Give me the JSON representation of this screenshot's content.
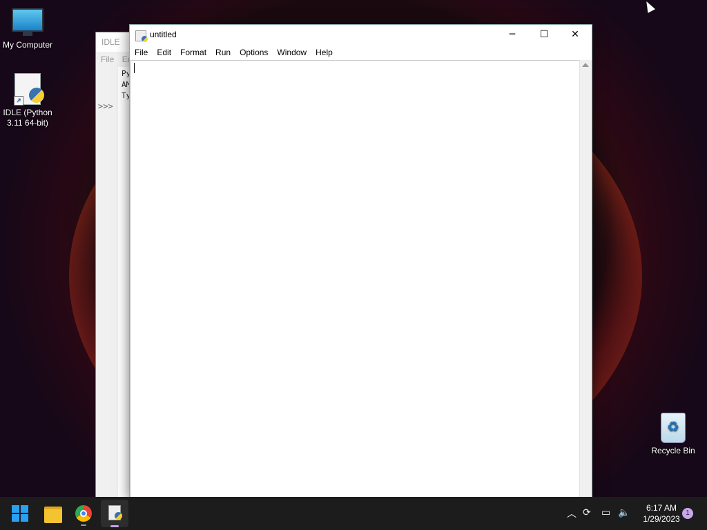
{
  "desktop": {
    "icons": [
      {
        "label": "My Computer",
        "icon": "monitor-icon"
      },
      {
        "label": "IDLE (Python 3.11 64-bit)",
        "icon": "python-shortcut-icon"
      },
      {
        "label": "Recycle Bin",
        "icon": "recycle-bin-icon"
      }
    ]
  },
  "shell_window": {
    "title": "IDLE",
    "menu_first": "File",
    "menu_second": "Ed",
    "lines": [
      "Py",
      "AM",
      "Ty"
    ],
    "prompt": ">>>"
  },
  "editor_window": {
    "title": "untitled",
    "controls": {
      "minimize": "─",
      "maximize": "☐",
      "close": "✕"
    },
    "menu": [
      "File",
      "Edit",
      "Format",
      "Run",
      "Options",
      "Window",
      "Help"
    ],
    "content": ""
  },
  "taskbar": {
    "apps": [
      "start-icon",
      "file-explorer-icon",
      "chrome-icon",
      "idle-icon"
    ],
    "tray": {
      "time": "6:17 AM",
      "date": "1/29/2023",
      "notification_count": "1"
    }
  },
  "colors": {
    "accent": "#2aa0f0",
    "taskbar": "#1c1c1c",
    "badge": "#c9a7ee"
  }
}
